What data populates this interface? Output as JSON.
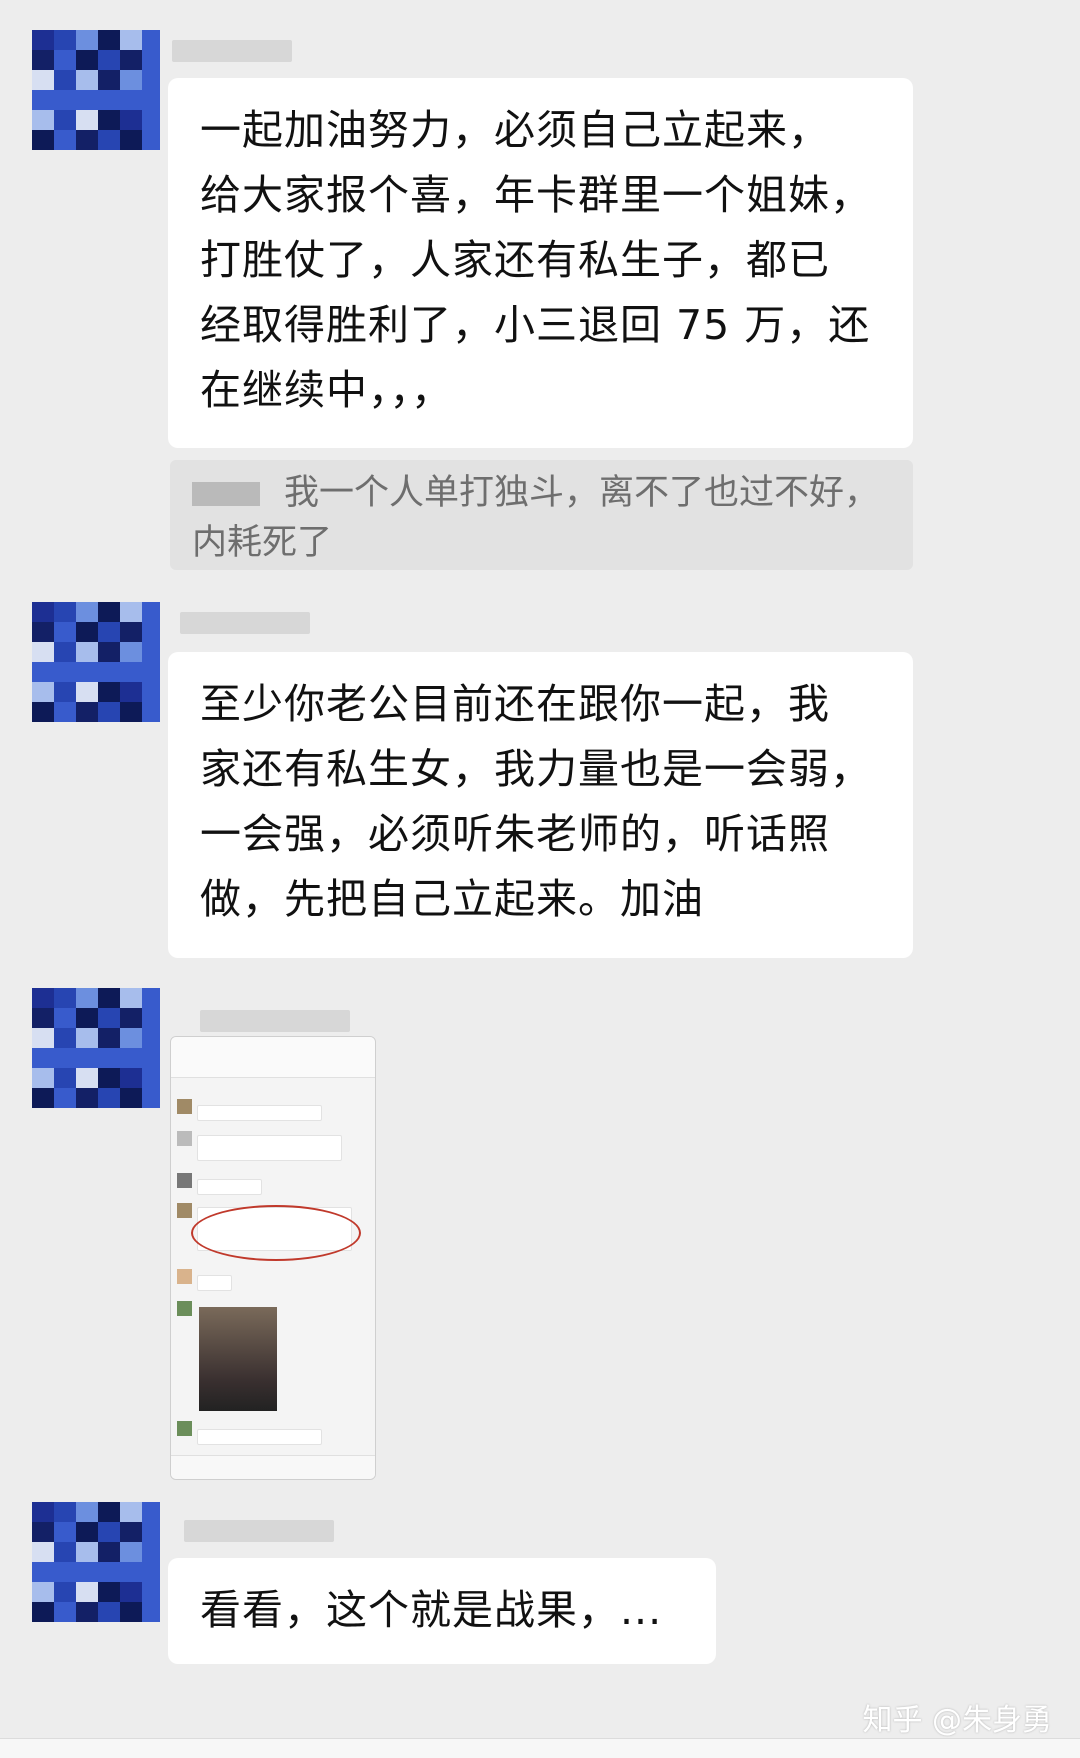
{
  "messages": [
    {
      "text_lines": [
        "一起加油努力，必须自己立起来，",
        "给大家报个喜，年卡群里一个姐妹，",
        "打胜仗了，人家还有私生子，都已",
        "经取得胜利了，小三退回 75 万，还",
        "在继续中，，，"
      ]
    },
    {
      "quote_text": "我一个人单打独斗，离不了也过不好，内耗死了"
    },
    {
      "text_lines": [
        "至少你老公目前还在跟你一起，我",
        "家还有私生女，我力量也是一会弱，",
        "一会强，必须听朱老师的，听话照",
        "做，先把自己立起来。加油"
      ]
    },
    {
      "image_caption": ""
    },
    {
      "text_lines": [
        "看看，这个就是战果，..."
      ]
    }
  ],
  "watermark": "知乎 @朱身勇",
  "colors": {
    "background": "#ededed",
    "bubble": "#ffffff",
    "quote": "#e2e2e2"
  }
}
